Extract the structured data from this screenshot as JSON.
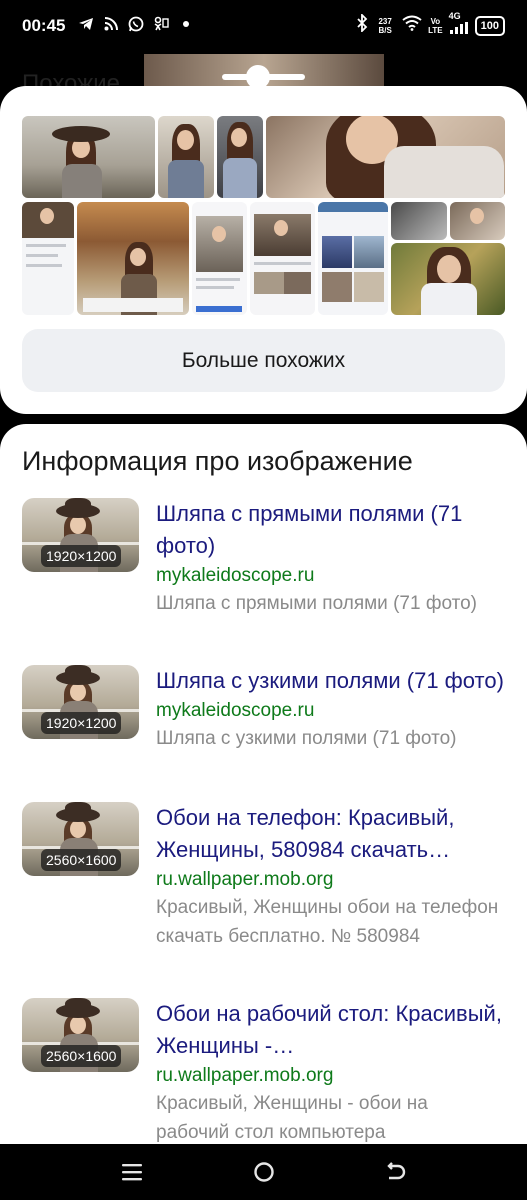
{
  "status_bar": {
    "time": "00:45",
    "net_speed_value": "237",
    "net_speed_unit": "B/S",
    "volte_top": "Vo",
    "volte_bottom": "LTE",
    "network": "4G",
    "battery": "100",
    "left_icons": [
      "telegram-icon",
      "rss-icon",
      "whatsapp-icon",
      "odnoklassniki-icon",
      "dot-icon"
    ],
    "right_icons": [
      "bluetooth-icon",
      "wifi-icon",
      "signal-icon"
    ]
  },
  "similar_section": {
    "title_partial": "Похожие",
    "more_button": "Больше похожих"
  },
  "info_section": {
    "title": "Информация про изображение",
    "results": [
      {
        "dimensions": "1920×1200",
        "title": "Шляпа с прямыми полями (71 фото)",
        "domain": "mykaleidoscope.ru",
        "snippet": "Шляпа с прямыми полями (71 фото)"
      },
      {
        "dimensions": "1920×1200",
        "title": "Шляпа с узкими полями (71 фото)",
        "domain": "mykaleidoscope.ru",
        "snippet": "Шляпа с узкими полями (71 фото)"
      },
      {
        "dimensions": "2560×1600",
        "title": "Обои на телефон: Красивый, Женщины, 580984 скачать…",
        "domain": "ru.wallpaper.mob.org",
        "snippet": "Красивый, Женщины обои на телефон скачать бесплатно. № 580984"
      },
      {
        "dimensions": "2560×1600",
        "title": "Обои на рабочий стол: Красивый, Женщины -…",
        "domain": "ru.wallpaper.mob.org",
        "snippet": "Красивый, Женщины - обои на рабочий стол компьютера"
      }
    ]
  },
  "nav_bar": {
    "buttons": [
      "menu-icon",
      "home-icon",
      "back-icon"
    ]
  },
  "colors": {
    "link": "#1b1b7e",
    "domain": "#0e7a1a",
    "snippet": "#8a8a8a",
    "button_bg": "#eef0f3"
  }
}
